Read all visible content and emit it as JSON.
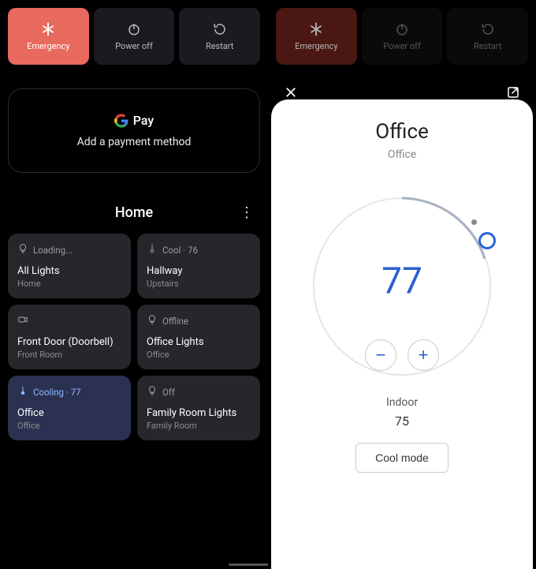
{
  "power": {
    "emergency": "Emergency",
    "power_off": "Power off",
    "restart": "Restart"
  },
  "pay": {
    "title": "Pay",
    "subtitle": "Add a payment method"
  },
  "home": {
    "title": "Home"
  },
  "devices": [
    {
      "status": "Loading...",
      "name": "All Lights",
      "loc": "Home",
      "icon": "bulb"
    },
    {
      "status": "Cool · 76",
      "name": "Hallway",
      "loc": "Upstairs",
      "icon": "thermo"
    },
    {
      "status": "",
      "name": "Front Door (Doorbell)",
      "loc": "Front Room",
      "icon": "cam"
    },
    {
      "status": "Offline",
      "name": "Office Lights",
      "loc": "Office",
      "icon": "bulb"
    },
    {
      "status": "Cooling · 77",
      "name": "Office",
      "loc": "Office",
      "icon": "thermo",
      "active": true
    },
    {
      "status": "Off",
      "name": "Family Room Lights",
      "loc": "Family Room",
      "icon": "bulb"
    }
  ],
  "thermo": {
    "title": "Office",
    "subtitle": "Office",
    "set_temp": "77",
    "indoor_label": "Indoor",
    "indoor_temp": "75",
    "mode": "Cool mode"
  }
}
